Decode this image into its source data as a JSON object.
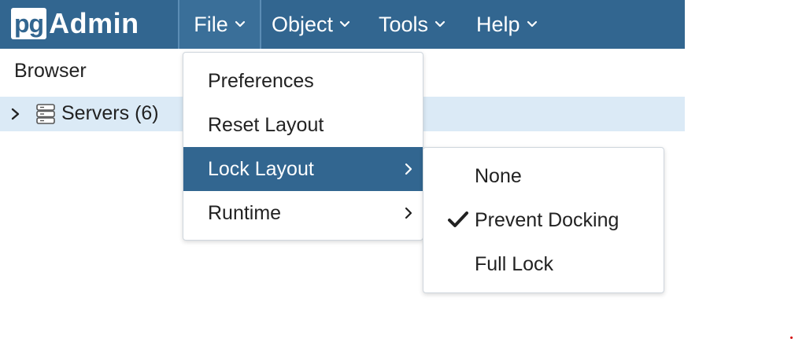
{
  "app": {
    "logo_badge": "pg",
    "logo_text": "Admin"
  },
  "navbar": {
    "items": [
      {
        "label": "File"
      },
      {
        "label": "Object"
      },
      {
        "label": "Tools"
      },
      {
        "label": "Help"
      }
    ],
    "background": "#326690"
  },
  "browser": {
    "title": "Browser",
    "tree": [
      {
        "label": "Servers (6)",
        "icon": "server-group-icon",
        "expanded": false
      }
    ]
  },
  "file_menu": {
    "items": [
      {
        "label": "Preferences"
      },
      {
        "label": "Reset Layout"
      },
      {
        "label": "Lock Layout",
        "has_submenu": true,
        "active": true
      },
      {
        "label": "Runtime",
        "has_submenu": true
      }
    ]
  },
  "lock_layout_submenu": {
    "items": [
      {
        "label": "None",
        "checked": false
      },
      {
        "label": "Prevent Docking",
        "checked": true
      },
      {
        "label": "Full Lock",
        "checked": false
      }
    ]
  },
  "colors": {
    "accent": "#326690",
    "selected_row": "#dbeaf6",
    "marker_dot": "#d40000"
  }
}
